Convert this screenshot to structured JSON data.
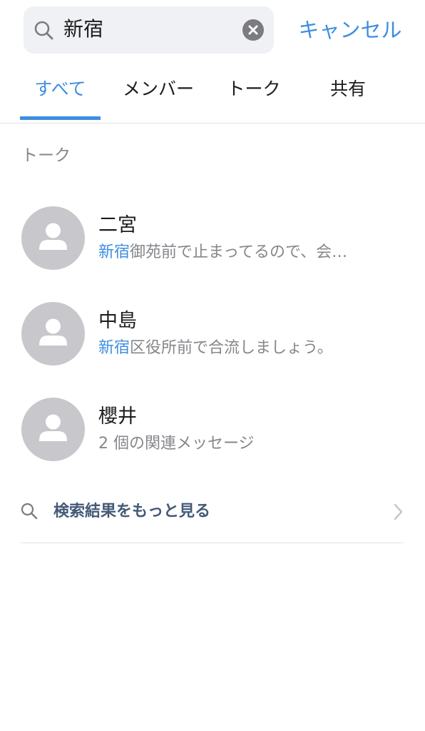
{
  "search": {
    "query": "新宿",
    "cancel_label": "キャンセル"
  },
  "tabs": [
    {
      "label": "すべて",
      "active": true
    },
    {
      "label": "メンバー",
      "active": false
    },
    {
      "label": "トーク",
      "active": false
    },
    {
      "label": "共有",
      "active": false
    }
  ],
  "section": {
    "title": "トーク"
  },
  "results": [
    {
      "name": "二宮",
      "snippet_highlight": "新宿",
      "snippet_rest": "御苑前で止まってるので、会…"
    },
    {
      "name": "中島",
      "snippet_highlight": "新宿",
      "snippet_rest": "区役所前で合流しましょう。"
    },
    {
      "name": "櫻井",
      "snippet_highlight": "",
      "snippet_rest": "2 個の関連メッセージ"
    }
  ],
  "more": {
    "label": "検索結果をもっと見る"
  },
  "colors": {
    "accent": "#3e8de0",
    "more_link": "#445a78",
    "secondary_text": "#86868b",
    "avatar_bg": "#c7c7cc",
    "search_bg": "#f0f1f4"
  },
  "icons": {
    "search": "search-icon",
    "clear": "clear-icon",
    "avatar": "person-silhouette-icon",
    "chevron": "chevron-right-icon"
  }
}
